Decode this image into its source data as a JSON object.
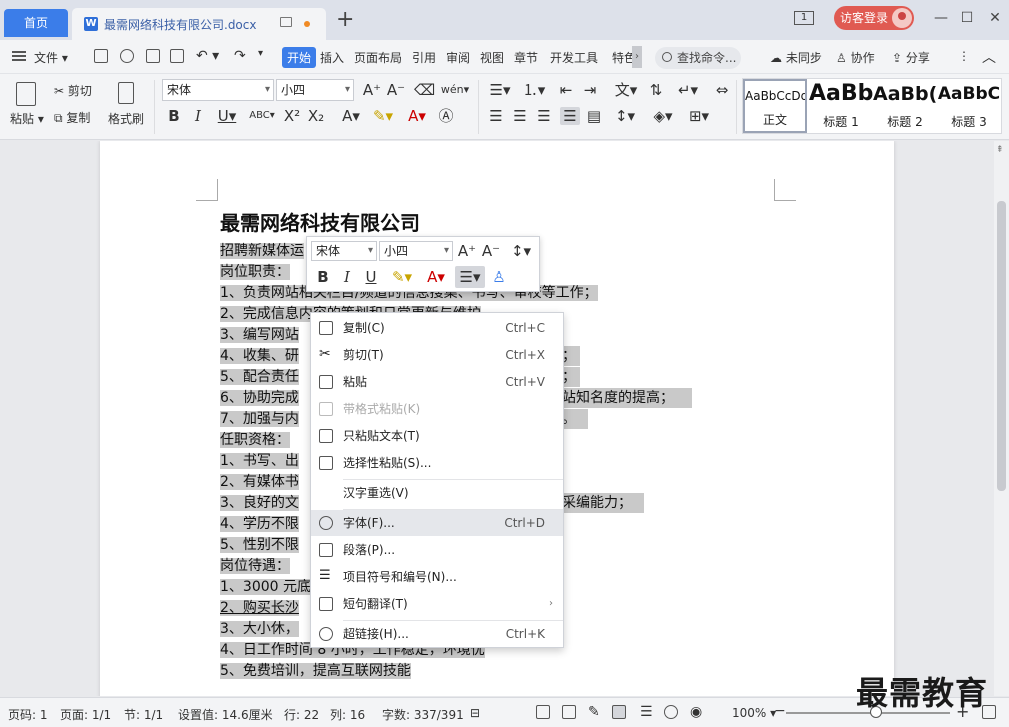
{
  "titlebar": {
    "home_tab": "首页",
    "doc_tab": "最需网络科技有限公司.docx",
    "new_tab": "+",
    "page_indicator": "1",
    "login": "访客登录",
    "minimize": "—",
    "maximize": "☐",
    "close": "✕"
  },
  "menubar": {
    "file": "文件",
    "items": [
      "开始",
      "插入",
      "页面布局",
      "引用",
      "审阅",
      "视图",
      "章节",
      "开发工具",
      "特色"
    ],
    "search": "查找命令...",
    "sync": "未同步",
    "collab": "协作",
    "share": "分享"
  },
  "ribbon": {
    "paste": "粘贴",
    "cut": "剪切",
    "copy": "复制",
    "format_painter": "格式刷",
    "font_name": "宋体",
    "font_size": "小四",
    "styles": [
      {
        "preview": "AaBbCcDd",
        "name": "正文"
      },
      {
        "preview": "AaBb",
        "name": "标题 1"
      },
      {
        "preview": "AaBb(",
        "name": "标题 2"
      },
      {
        "preview": "AaBbC",
        "name": "标题 3"
      }
    ]
  },
  "document": {
    "title": "最需网络科技有限公司",
    "lines": [
      "招聘新媒体运",
      "岗位职责：",
      "1、负责网站相关栏目/频道的信息搜集、书写、审校等工作；",
      "2、完成信息内容的策划和日常更新与维护",
      "3、编写网站",
      "4、收集、研",
      "5、配合责任",
      "6、协助完成",
      "7、加强与内",
      "任职资格：",
      "1、书写、出",
      "2、有媒体书",
      "3、良好的文",
      "4、学历不限",
      "5、性别不限",
      "岗位待遇：",
      "1、3000 元底",
      "2、购买长沙",
      "3、大小休，",
      "4、日工作时间 8 小时，工作稳定，环境优",
      "5、免费培训，提高互联网技能"
    ],
    "tails": {
      "l4": "；",
      "l5": "；",
      "l6": "站知名度的提高；",
      "l7": "。",
      "l12": "采编能力；"
    }
  },
  "mini_toolbar": {
    "font_name": "宋体",
    "font_size": "小四"
  },
  "context_menu": [
    {
      "label": "复制(C)",
      "shortcut": "Ctrl+C",
      "icon": "copy-icon"
    },
    {
      "label": "剪切(T)",
      "shortcut": "Ctrl+X",
      "icon": "scissors-icon"
    },
    {
      "label": "粘贴",
      "shortcut": "Ctrl+V",
      "icon": "paste-icon"
    },
    {
      "label": "带格式粘贴(K)",
      "shortcut": "",
      "icon": "paste-format-icon",
      "disabled": true
    },
    {
      "label": "只粘贴文本(T)",
      "shortcut": "",
      "icon": "paste-text-icon"
    },
    {
      "label": "选择性粘贴(S)...",
      "shortcut": "",
      "icon": "paste-special-icon"
    },
    {
      "label": "汉字重选(V)",
      "shortcut": "",
      "icon": ""
    },
    {
      "label": "字体(F)...",
      "shortcut": "Ctrl+D",
      "icon": "font-icon"
    },
    {
      "label": "段落(P)...",
      "shortcut": "",
      "icon": "paragraph-icon"
    },
    {
      "label": "项目符号和编号(N)...",
      "shortcut": "",
      "icon": "list-icon"
    },
    {
      "label": "短句翻译(T)",
      "shortcut": "",
      "icon": "translate-icon",
      "submenu": true
    },
    {
      "label": "超链接(H)...",
      "shortcut": "Ctrl+K",
      "icon": "link-icon"
    }
  ],
  "statusbar": {
    "page_code": "页码: 1",
    "page": "页面: 1/1",
    "section": "节: 1/1",
    "setting": "设置值: 14.6厘米",
    "row": "行: 22",
    "col": "列: 16",
    "words": "字数: 337/391",
    "zoom": "100%",
    "zoom_minus": "−",
    "zoom_plus": "+"
  },
  "watermark": "最需教育"
}
